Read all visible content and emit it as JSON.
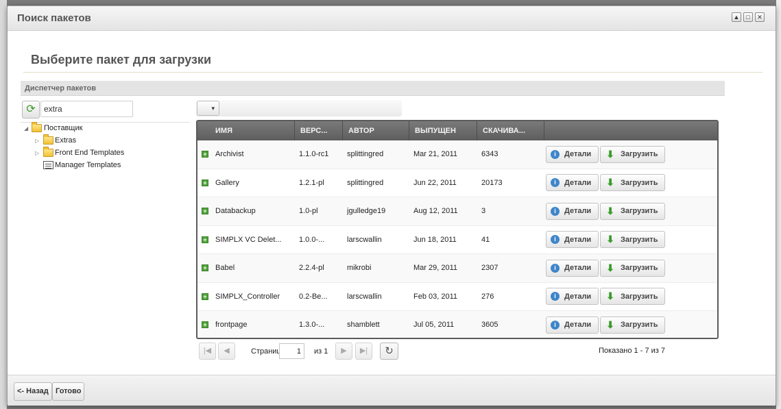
{
  "window": {
    "title": "Поиск пакетов",
    "tools": [
      "▲",
      "□",
      "✕"
    ]
  },
  "page_title": "Выберите пакет для загрузки",
  "panel_title": "Диспетчер пакетов",
  "search": {
    "value": "extra"
  },
  "tree": {
    "root": "Поставщик",
    "children": [
      {
        "label": "Extras",
        "icon": "folder-icon",
        "expandable": true
      },
      {
        "label": "Front End Templates",
        "icon": "folder-icon",
        "expandable": true
      },
      {
        "label": "Manager Templates",
        "icon": "template-icon",
        "expandable": false
      }
    ]
  },
  "grid": {
    "columns": [
      "ИМЯ",
      "ВЕРС...",
      "АВТОР",
      "ВЫПУЩЕН",
      "СКАЧИВА..."
    ],
    "details_label": "Детали",
    "download_label": "Загрузить",
    "rows": [
      {
        "name": "Archivist",
        "version": "1.1.0-rc1",
        "author": "splittingred",
        "released": "Mar 21, 2011",
        "downloads": "6343"
      },
      {
        "name": "Gallery",
        "version": "1.2.1-pl",
        "author": "splittingred",
        "released": "Jun 22, 2011",
        "downloads": "20173"
      },
      {
        "name": "Databackup",
        "version": "1.0-pl",
        "author": "jgulledge19",
        "released": "Aug 12, 2011",
        "downloads": "3"
      },
      {
        "name": "SIMPLX VC Delet...",
        "version": "1.0.0-...",
        "author": "larscwallin",
        "released": "Jun 18, 2011",
        "downloads": "41"
      },
      {
        "name": "Babel",
        "version": "2.2.4-pl",
        "author": "mikrobi",
        "released": "Mar 29, 2011",
        "downloads": "2307"
      },
      {
        "name": "SIMPLX_Controller",
        "version": "0.2-Be...",
        "author": "larscwallin",
        "released": "Feb 03, 2011",
        "downloads": "276"
      },
      {
        "name": "frontpage",
        "version": "1.3.0-...",
        "author": "shamblett",
        "released": "Jul 05, 2011",
        "downloads": "3605"
      }
    ]
  },
  "pager": {
    "page_label": "Страница",
    "page_value": "1",
    "of_label": "из 1",
    "summary": "Показано 1 - 7 из 7"
  },
  "footer": {
    "back_label": "<- Назад",
    "done_label": "Готово"
  }
}
